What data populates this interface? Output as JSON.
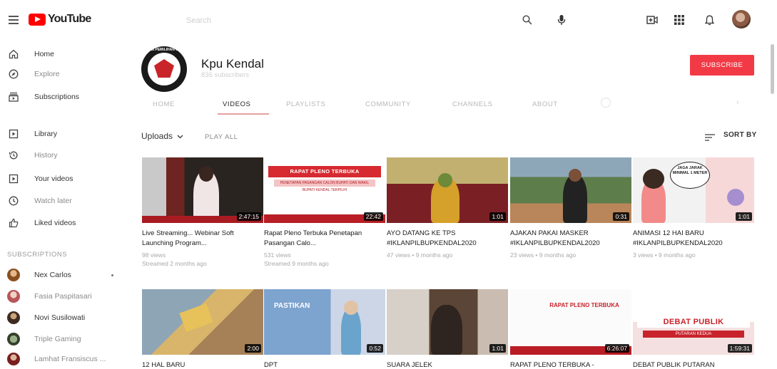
{
  "app": {
    "logo_text": "YouTube",
    "search_placeholder": "Search"
  },
  "icons": {
    "menu": "hamburger-menu-icon",
    "search": "search-icon",
    "mic": "microphone-icon",
    "create": "create-video-icon",
    "apps": "apps-grid-icon",
    "notifications": "bell-icon"
  },
  "colors": {
    "brand_red": "#ff0000",
    "subscribe": "#f23a46"
  },
  "sidebar": {
    "items": [
      {
        "label": "Home",
        "icon": "home-icon"
      },
      {
        "label": "Explore",
        "icon": "compass-icon"
      },
      {
        "label": "Subscriptions",
        "icon": "subscriptions-icon"
      },
      {
        "label": "Library",
        "icon": "library-icon"
      },
      {
        "label": "History",
        "icon": "history-icon"
      },
      {
        "label": "Your videos",
        "icon": "your-videos-icon"
      },
      {
        "label": "Watch later",
        "icon": "clock-icon"
      },
      {
        "label": "Liked videos",
        "icon": "thumbs-up-icon"
      }
    ],
    "subscriptions_heading": "SUBSCRIPTIONS",
    "subscriptions": [
      {
        "label": "Nex Carlos"
      },
      {
        "label": "Fasia Paspitasari"
      },
      {
        "label": "Novi Susilowati"
      },
      {
        "label": "Triple Gaming"
      },
      {
        "label": "Lamhat Fransiscus ..."
      }
    ]
  },
  "channel": {
    "name": "Kpu Kendal",
    "subscribers": "836 subscribers",
    "subscribe_label": "SUBSCRIBE",
    "avatar_ring_text": "KOMISI PEMILIHAN UMUM"
  },
  "tabs": [
    {
      "label": "HOME"
    },
    {
      "label": "VIDEOS",
      "active": true
    },
    {
      "label": "PLAYLISTS"
    },
    {
      "label": "COMMUNITY"
    },
    {
      "label": "CHANNELS"
    },
    {
      "label": "ABOUT"
    }
  ],
  "uploads": {
    "label": "Uploads",
    "play_all": "PLAY ALL",
    "sort_by": "SORT BY"
  },
  "videos": [
    {
      "title": "Live Streaming... Webinar Soft Launching Program...",
      "duration": "2:47:15",
      "views": "98 views",
      "age": "Streamed 2 months ago"
    },
    {
      "title": "Rapat Pleno Terbuka Penetapan Pasangan Calo...",
      "duration": "22:42",
      "views": "531 views",
      "age": "Streamed 9 months ago",
      "thumb_text": "RAPAT PLENO TERBUKA",
      "thumb_sub": "PENETAPAN PASANGAN CALON BUPATI DAN WAKIL BUPATI KENDAL TERPILIH"
    },
    {
      "title": "AYO DATANG KE TPS #IKLANPILBUPKENDAL2020",
      "duration": "1:01",
      "meta": "47 views • 9 months ago"
    },
    {
      "title": "AJAKAN PAKAI MASKER #IKLANPILBUPKENDAL2020",
      "duration": "0:31",
      "meta": "23 views • 9 months ago"
    },
    {
      "title": "ANIMASI 12 HAI BARU #IKLANPILBUPKENDAL2020",
      "duration": "1:01",
      "meta": "3 views • 9 months ago",
      "thumb_text": "JAGA JARAK MINIMAL 1 METER"
    },
    {
      "title": "12 HAL BARU",
      "duration": "2:00"
    },
    {
      "title": "DPT",
      "duration": "0:52",
      "thumb_text": "PASTIKAN"
    },
    {
      "title": "SUARA JELEK",
      "duration": "1:01"
    },
    {
      "title": "RAPAT PLENO TERBUKA -",
      "duration": "6:26:07",
      "thumb_text": "RAPAT PLENO TERBUKA"
    },
    {
      "title": "DEBAT PUBLIK PUTARAN",
      "duration": "1:59:31",
      "thumb_text": "DEBAT PUBLIK",
      "thumb_sub": "PUTARAN KEDUA"
    }
  ]
}
